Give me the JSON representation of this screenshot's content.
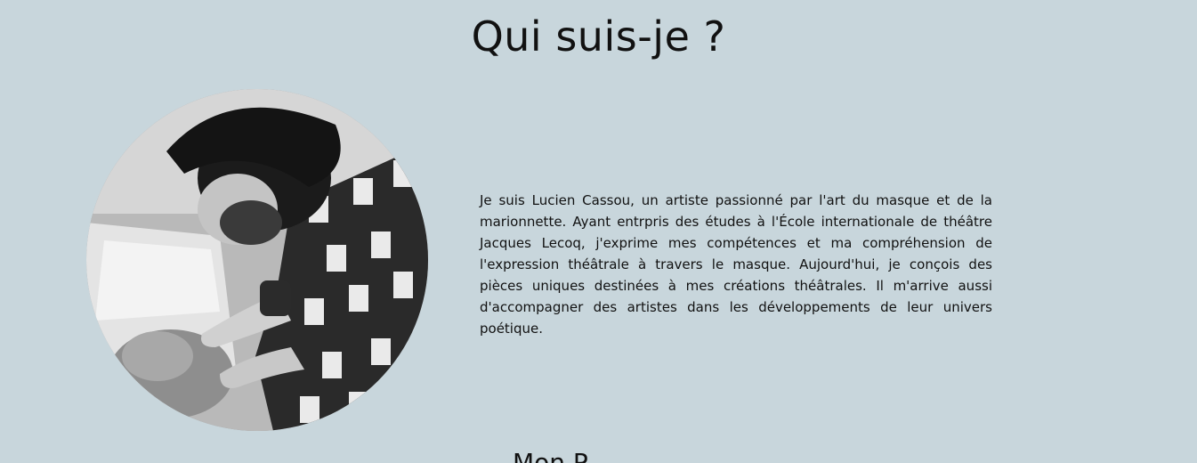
{
  "about": {
    "title": "Qui suis-je ?",
    "bio": "Je suis Lucien Cassou, un artiste passionné par l'art du masque et de la marionnette. Ayant entrpris des études à l'École internationale de théâtre Jacques Lecoq, j'exprime mes compétences et ma compréhension de l'expression théâtrale à travers le masque. Aujourd'hui, je conçois des pièces uniques destinées à mes créations théâtrales. Il m'arrive aussi d'accompagner des artistes dans les développements de leur univers poétique.",
    "next_section_title": "Mon P"
  },
  "colors": {
    "background": "#c8d6dc",
    "text": "#111111"
  }
}
